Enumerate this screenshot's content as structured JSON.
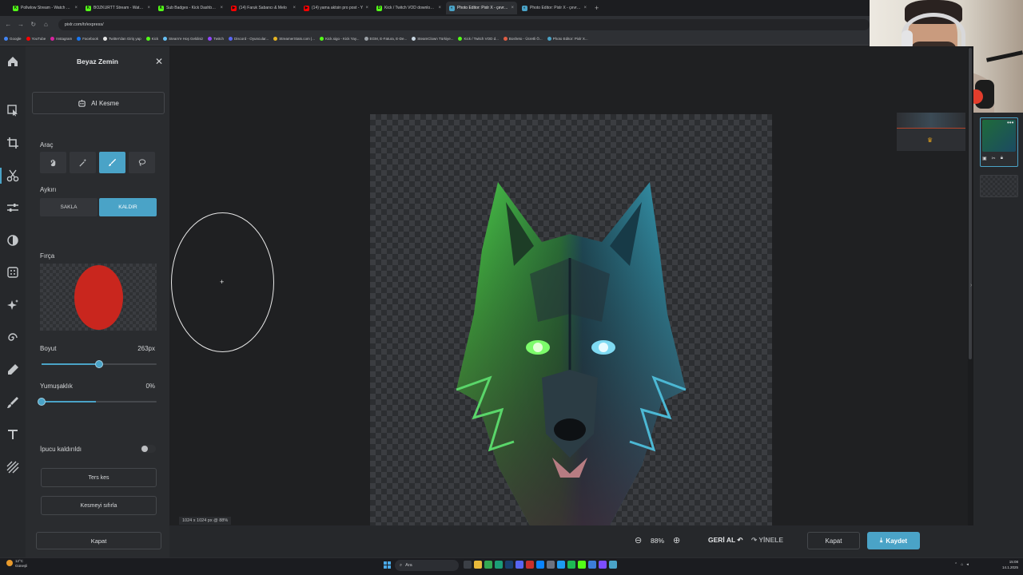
{
  "browser": {
    "tabs": [
      {
        "title": "Pollwlow Stream - Watch Live o",
        "favicon_color": "#53fc18",
        "favicon_letter": "K",
        "active": false
      },
      {
        "title": "BOZKURTT Stream - Watch Li",
        "favicon_color": "#53fc18",
        "favicon_letter": "K",
        "active": false
      },
      {
        "title": "Sub Badges - Kick Dashboard",
        "favicon_color": "#53fc18",
        "favicon_letter": "K",
        "active": false
      },
      {
        "title": "(14) Faruk Sabancı & Melo",
        "favicon_color": "#ff0000",
        "favicon_letter": "▶",
        "active": false
      },
      {
        "title": "(14) yama aktsin pro post - Y",
        "favicon_color": "#ff0000",
        "favicon_letter": "▶",
        "active": false
      },
      {
        "title": "Kick / Twitch VOD downloader",
        "favicon_color": "#53fc18",
        "favicon_letter": "D",
        "active": false
      },
      {
        "title": "Photo Editor: Pixlr X - çevrimi",
        "favicon_color": "#4aa3c7",
        "favicon_letter": "◐",
        "active": true
      },
      {
        "title": "Photo Editor: Pixlr X - çevrimi",
        "favicon_color": "#4aa3c7",
        "favicon_letter": "◐",
        "active": false
      }
    ],
    "new_tab": "+",
    "url": "pixlr.com/tr/express/",
    "bookmarks": [
      {
        "label": "Google",
        "color": "#4285f4"
      },
      {
        "label": "YouTube",
        "color": "#ff0000"
      },
      {
        "label": "Instagram",
        "color": "#d6249f"
      },
      {
        "label": "Facebook",
        "color": "#1877f2"
      },
      {
        "label": "Twitter'dan Giriş yap",
        "color": "#e6e6e6"
      },
      {
        "label": "Kick",
        "color": "#53fc18"
      },
      {
        "label": "Steam'e Hoş Geldiniz",
        "color": "#66c0f4"
      },
      {
        "label": "Twitch",
        "color": "#9146ff"
      },
      {
        "label": "Discord - Oyuncular...",
        "color": "#5865f2"
      },
      {
        "label": "StreamerStats.com |...",
        "color": "#e6b422"
      },
      {
        "label": "Kick.sigo - Kick Yay...",
        "color": "#53fc18"
      },
      {
        "label": "EGM, E-Fatura, E-De...",
        "color": "#9aa0a6"
      },
      {
        "label": "SteamClown Türkiye...",
        "color": "#c7d5e0"
      },
      {
        "label": "Kick / Twitch VOD d...",
        "color": "#53fc18"
      },
      {
        "label": "Bosheto - Ücretli Ö...",
        "color": "#e05d44"
      },
      {
        "label": "Photo Editor: Pixlr X...",
        "color": "#4aa3c7"
      }
    ]
  },
  "panel": {
    "title": "Beyaz Zemin",
    "ai_button": "AI Kesme",
    "tool_label": "Araç",
    "mode_label": "Aykırı",
    "mode_keep": "SAKLA",
    "mode_remove": "KALDIR",
    "brush_label": "Fırça",
    "brush_color": "#c9261e",
    "size_label": "Boyut",
    "size_value": "263px",
    "size_fraction": 0.5,
    "softness_label": "Yumuşaklık",
    "softness_value": "0%",
    "softness_fraction": 0.0,
    "hint_label": "İpucu kaldırıldı",
    "invert_button": "Ters kes",
    "reset_button": "Kesmeyi sıfırla",
    "close_button": "Kapat"
  },
  "canvas": {
    "info": "1024 x 1024 px @ 88%"
  },
  "bottom": {
    "zoom_value": "88%",
    "undo": "GERİ AL",
    "redo": "YİNELE",
    "close": "Kapat",
    "save": "Kaydet"
  },
  "taskbar": {
    "weather_temp": "12°C",
    "weather_desc": "Güneşli",
    "search": "Ara",
    "time": "15:08",
    "date": "14.1.2025"
  },
  "colors": {
    "accent": "#4aa3c7",
    "panel_bg": "#2a2c2f",
    "workspace_bg": "#1f2022"
  }
}
